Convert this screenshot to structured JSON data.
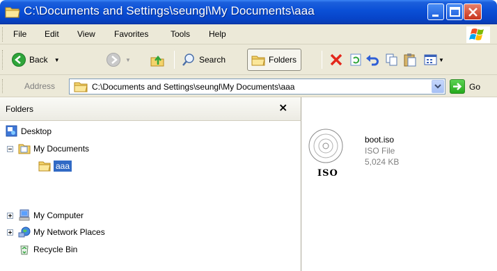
{
  "window": {
    "title": "C:\\Documents and Settings\\seungl\\My Documents\\aaa"
  },
  "menu": {
    "items": [
      "File",
      "Edit",
      "View",
      "Favorites",
      "Tools",
      "Help"
    ]
  },
  "toolbar": {
    "back_label": "Back",
    "search_label": "Search",
    "folders_label": "Folders"
  },
  "address": {
    "label": "Address",
    "value": "C:\\Documents and Settings\\seungl\\My Documents\\aaa",
    "go_label": "Go"
  },
  "folders_pane": {
    "title": "Folders",
    "close_glyph": "×",
    "tree": [
      {
        "label": "Desktop",
        "icon": "desktop-icon",
        "expander": "none"
      },
      {
        "label": "My Documents",
        "icon": "my-documents-icon",
        "expander": "minus"
      },
      {
        "label": "aaa",
        "icon": "folder-open-icon",
        "expander": "none",
        "selected": true
      },
      {
        "label": "My Computer",
        "icon": "computer-icon",
        "expander": "plus"
      },
      {
        "label": "My Network Places",
        "icon": "network-places-icon",
        "expander": "plus"
      },
      {
        "label": "Recycle Bin",
        "icon": "recycle-bin-icon",
        "expander": "none"
      }
    ]
  },
  "files": [
    {
      "name": "boot.iso",
      "type": "ISO File",
      "size": "5,024 KB",
      "icon_text": "ISO"
    }
  ],
  "colors": {
    "titlebar": "#0a4fd6",
    "selection": "#316ac5",
    "chrome": "#ece9d8"
  }
}
